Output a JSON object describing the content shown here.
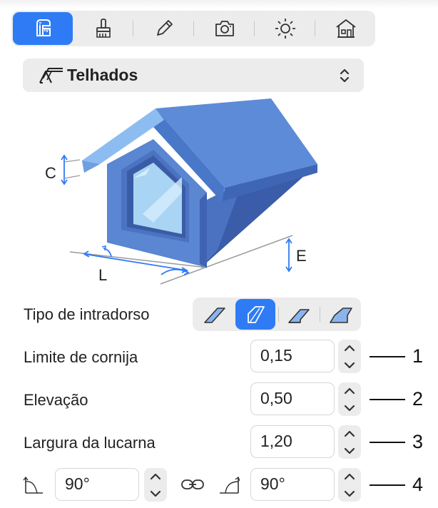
{
  "toolbar": {
    "tabs": [
      {
        "icon": "ruler-dimensions-icon",
        "active": true
      },
      {
        "icon": "paint-brush-icon",
        "active": false
      },
      {
        "icon": "pencil-icon",
        "active": false
      },
      {
        "icon": "camera-icon",
        "active": false
      },
      {
        "icon": "sun-icon",
        "active": false
      },
      {
        "icon": "house-icon",
        "active": false
      }
    ]
  },
  "category": {
    "label": "Telhados",
    "icon": "roof-icon"
  },
  "diagram": {
    "labels": {
      "c": "C",
      "l": "L",
      "e": "E"
    }
  },
  "soffit": {
    "label": "Tipo de intradorso",
    "selected_index": 1
  },
  "rows": {
    "cornice": {
      "label": "Limite de cornija",
      "value": "0,15",
      "callout": "1"
    },
    "elevation": {
      "label": "Elevação",
      "value": "0,50",
      "callout": "2"
    },
    "width": {
      "label": "Largura da lucarna",
      "value": "1,20",
      "callout": "3"
    },
    "angles": {
      "left_value": "90°",
      "right_value": "90°",
      "callout": "4"
    }
  },
  "colors": {
    "accent": "#2f7bf6",
    "panel": "#ececec"
  }
}
